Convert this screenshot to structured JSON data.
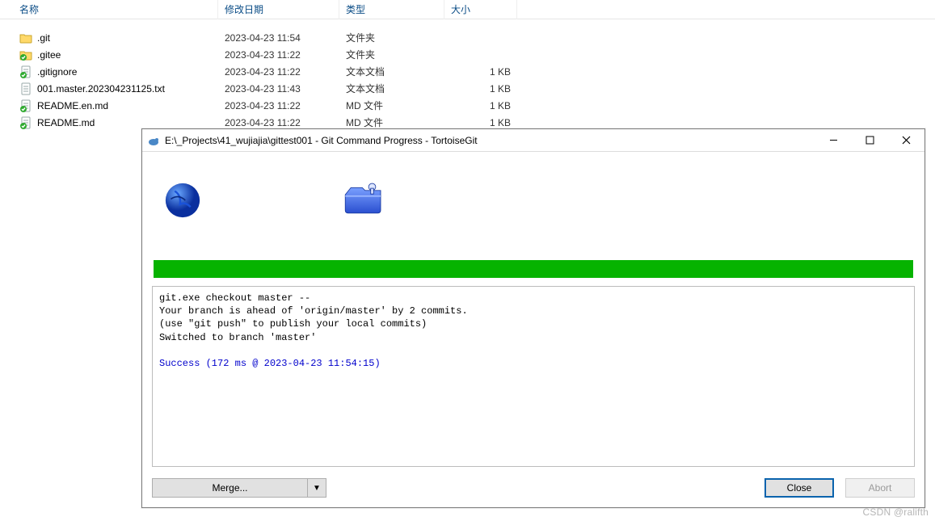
{
  "explorer": {
    "columns": {
      "name": "名称",
      "date": "修改日期",
      "type": "类型",
      "size": "大小"
    },
    "files": [
      {
        "icon": "folder",
        "name": ".git",
        "date": "2023-04-23 11:54",
        "type": "文件夹",
        "size": ""
      },
      {
        "icon": "folder-ok",
        "name": ".gitee",
        "date": "2023-04-23 11:22",
        "type": "文件夹",
        "size": ""
      },
      {
        "icon": "txt-ok",
        "name": ".gitignore",
        "date": "2023-04-23 11:22",
        "type": "文本文档",
        "size": "1 KB"
      },
      {
        "icon": "txt",
        "name": "001.master.202304231125.txt",
        "date": "2023-04-23 11:43",
        "type": "文本文档",
        "size": "1 KB"
      },
      {
        "icon": "md-ok",
        "name": "README.en.md",
        "date": "2023-04-23 11:22",
        "type": "MD 文件",
        "size": "1 KB"
      },
      {
        "icon": "md-ok",
        "name": "README.md",
        "date": "2023-04-23 11:22",
        "type": "MD 文件",
        "size": "1 KB"
      }
    ]
  },
  "dialog": {
    "title": "E:\\_Projects\\41_wujiajia\\gittest001 - Git Command Progress - TortoiseGit",
    "output_lines": {
      "l1": "git.exe checkout master --",
      "l2": "Your branch is ahead of 'origin/master' by 2 commits.",
      "l3": "(use \"git push\" to publish your local commits)",
      "l4": "Switched to branch 'master'",
      "blank": "",
      "success": "Success (172 ms @ 2023-04-23 11:54:15)"
    },
    "buttons": {
      "merge": "Merge...",
      "close": "Close",
      "abort": "Abort"
    }
  },
  "watermark": "CSDN @ralifth"
}
